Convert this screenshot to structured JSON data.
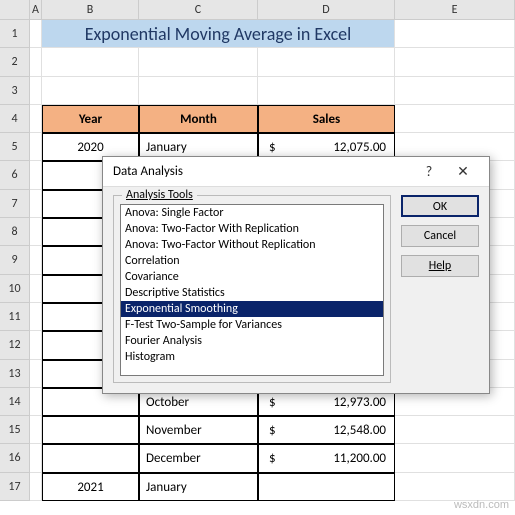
{
  "columns": [
    "A",
    "B",
    "C",
    "D",
    "E"
  ],
  "title": "Exponential Moving Average in Excel",
  "headers": {
    "year": "Year",
    "month": "Month",
    "sales": "Sales"
  },
  "rows": [
    {
      "n": 5,
      "year": "2020",
      "month": "January",
      "cur": "$",
      "sales": "12,075.00"
    },
    {
      "n": 6,
      "year": "",
      "month": "",
      "cur": "",
      "sales": ""
    },
    {
      "n": 7,
      "year": "",
      "month": "",
      "cur": "",
      "sales": ""
    },
    {
      "n": 8,
      "year": "",
      "month": "",
      "cur": "",
      "sales": ""
    },
    {
      "n": 9,
      "year": "",
      "month": "",
      "cur": "",
      "sales": ""
    },
    {
      "n": 10,
      "year": "",
      "month": "",
      "cur": "",
      "sales": ""
    },
    {
      "n": 11,
      "year": "",
      "month": "",
      "cur": "",
      "sales": ""
    },
    {
      "n": 12,
      "year": "",
      "month": "",
      "cur": "",
      "sales": ""
    },
    {
      "n": 13,
      "year": "",
      "month": "",
      "cur": "",
      "sales": ""
    },
    {
      "n": 14,
      "year": "",
      "month": "October",
      "cur": "$",
      "sales": "12,973.00"
    },
    {
      "n": 15,
      "year": "",
      "month": "November",
      "cur": "$",
      "sales": "12,548.00"
    },
    {
      "n": 16,
      "year": "",
      "month": "December",
      "cur": "$",
      "sales": "11,200.00"
    },
    {
      "n": 17,
      "year": "2021",
      "month": "January",
      "cur": "",
      "sales": ""
    }
  ],
  "dialog": {
    "title": "Data Analysis",
    "help_icon": "?",
    "close_icon": "✕",
    "group_label": "Analysis Tools",
    "tools": [
      "Anova: Single Factor",
      "Anova: Two-Factor With Replication",
      "Anova: Two-Factor Without Replication",
      "Correlation",
      "Covariance",
      "Descriptive Statistics",
      "Exponential Smoothing",
      "F-Test Two-Sample for Variances",
      "Fourier Analysis",
      "Histogram"
    ],
    "selected_index": 6,
    "buttons": {
      "ok": "OK",
      "cancel": "Cancel",
      "help": "Help"
    }
  },
  "watermark": "wsxdn.com"
}
